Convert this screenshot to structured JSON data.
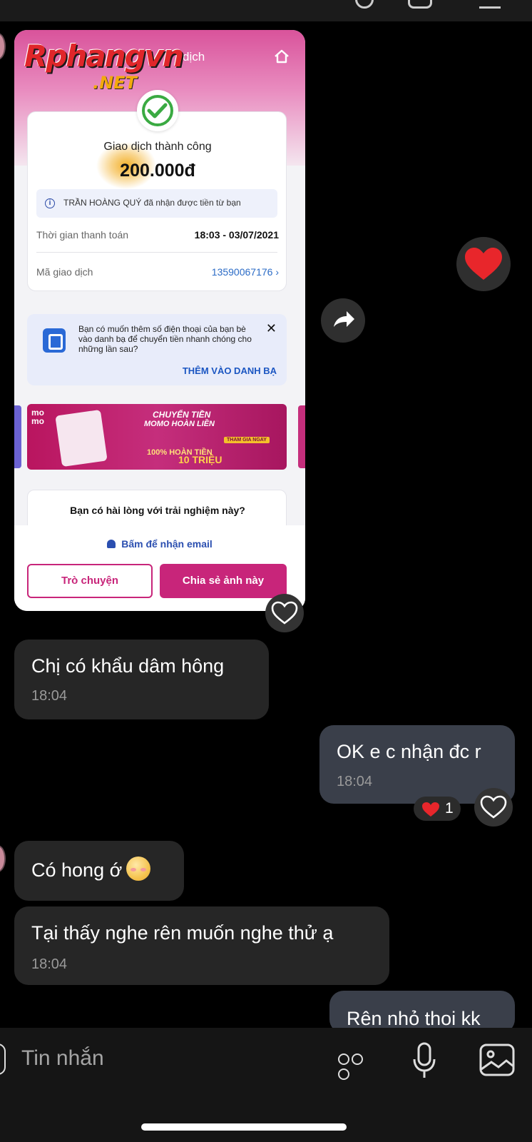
{
  "shared_image": {
    "watermark_main": "Rphangvn",
    "watermark_sub": ".NET",
    "header_title": "dịch",
    "success_title": "Giao dịch thành công",
    "amount": "200.000đ",
    "receiver_note": "TRẦN HOÀNG QUÝ đã nhận được tiền từ bạn",
    "payment_time_label": "Thời gian thanh toán",
    "payment_time_value": "18:03 - 03/07/2021",
    "transaction_id_label": "Mã giao dịch",
    "transaction_id_value": "13590067176",
    "contact_prompt": "Bạn có muốn thêm số điện thoại của bạn bè vào danh bạ để chuyển tiền nhanh chóng cho những lần sau?",
    "add_contact_label": "THÊM VÀO DANH BẠ",
    "banner": {
      "brand": "mo mo",
      "line1": "CHUYỂN TIỀN",
      "line2": "MOMO HOÀN LIỀN",
      "tag": "THAM GIA NGAY",
      "line3": "100% HOÀN TIỀN",
      "line4": "10 TRIỆU"
    },
    "rating_question": "Bạn có hài lòng với trải nghiệm này?",
    "email_prompt": "Bấm để nhận email",
    "chat_button": "Trò chuyện",
    "share_button": "Chia sẻ ảnh này"
  },
  "messages": [
    {
      "text": "Chị có khẩu dâm hông",
      "time": "18:04",
      "side": "left"
    },
    {
      "text": "OK e c nhận đc r",
      "time": "18:04",
      "side": "right",
      "reaction_count": "1"
    },
    {
      "text": "Có hong ớ",
      "side": "left"
    },
    {
      "text": "Tại thấy nghe rên muốn nghe thử ạ",
      "time": "18:04",
      "side": "left"
    },
    {
      "text": "Rên nhỏ thoi kk",
      "side": "right"
    }
  ],
  "composer": {
    "placeholder": "Tin nhắn"
  },
  "icons": {
    "reaction": "heart-icon",
    "forward": "forward-icon",
    "like": "heart-outline-icon",
    "more": "more-dots-icon",
    "mic": "mic-icon",
    "gallery": "gallery-icon"
  },
  "colors": {
    "accent": "#c8257a",
    "heart": "#e8262b",
    "bubble_in": "#262626",
    "bubble_out": "#3a3f4a"
  }
}
